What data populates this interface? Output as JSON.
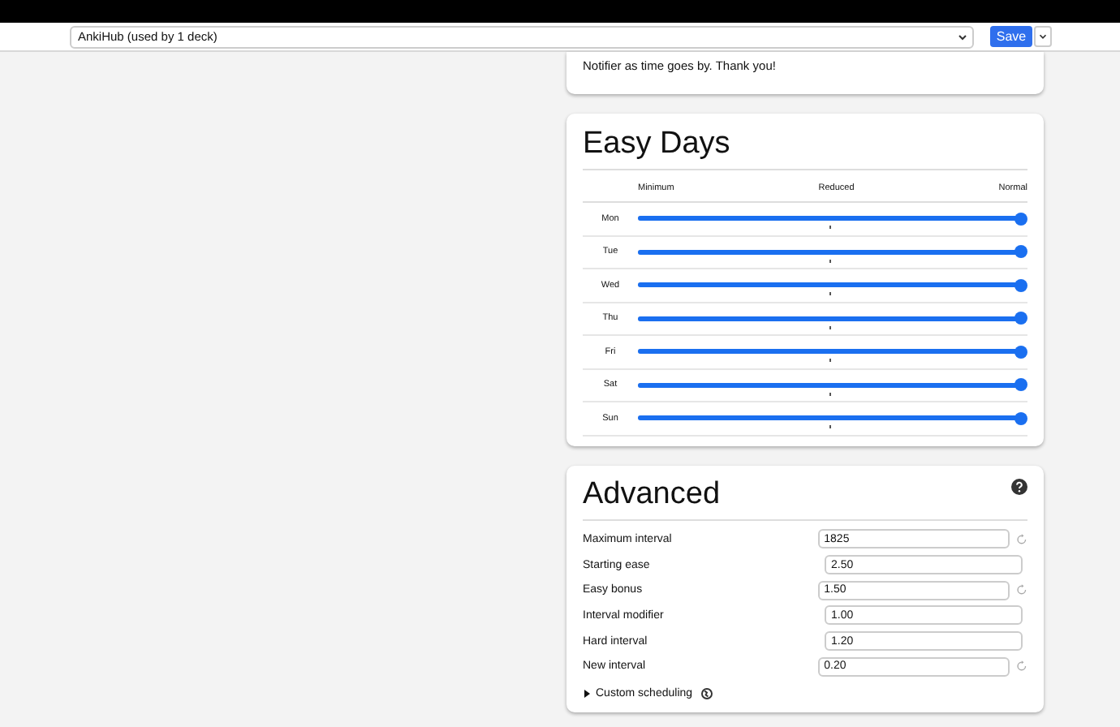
{
  "toolbar": {
    "preset": "AnkiHub (used by 1 deck)",
    "save_label": "Save"
  },
  "notice_card": {
    "text": "Notifier as time goes by. Thank you!"
  },
  "easy_days": {
    "title": "Easy Days",
    "scale_labels": [
      "Minimum",
      "Reduced",
      "Normal"
    ],
    "days": [
      {
        "day": "Mon",
        "level": 1
      },
      {
        "day": "Tue",
        "level": 1
      },
      {
        "day": "Wed",
        "level": 1
      },
      {
        "day": "Thu",
        "level": 1
      },
      {
        "day": "Fri",
        "level": 1
      },
      {
        "day": "Sat",
        "level": 1
      },
      {
        "day": "Sun",
        "level": 1
      }
    ]
  },
  "advanced": {
    "title": "Advanced",
    "fields": [
      {
        "label": "Maximum interval",
        "value": "1825",
        "reset": true
      },
      {
        "label": "Starting ease",
        "value": "2.50",
        "reset": false
      },
      {
        "label": "Easy bonus",
        "value": "1.50",
        "reset": true
      },
      {
        "label": "Interval modifier",
        "value": "1.00",
        "reset": false
      },
      {
        "label": "Hard interval",
        "value": "1.20",
        "reset": false
      },
      {
        "label": "New interval",
        "value": "0.20",
        "reset": true
      }
    ],
    "custom_scheduling": {
      "label": "Custom scheduling",
      "expanded": false
    }
  }
}
